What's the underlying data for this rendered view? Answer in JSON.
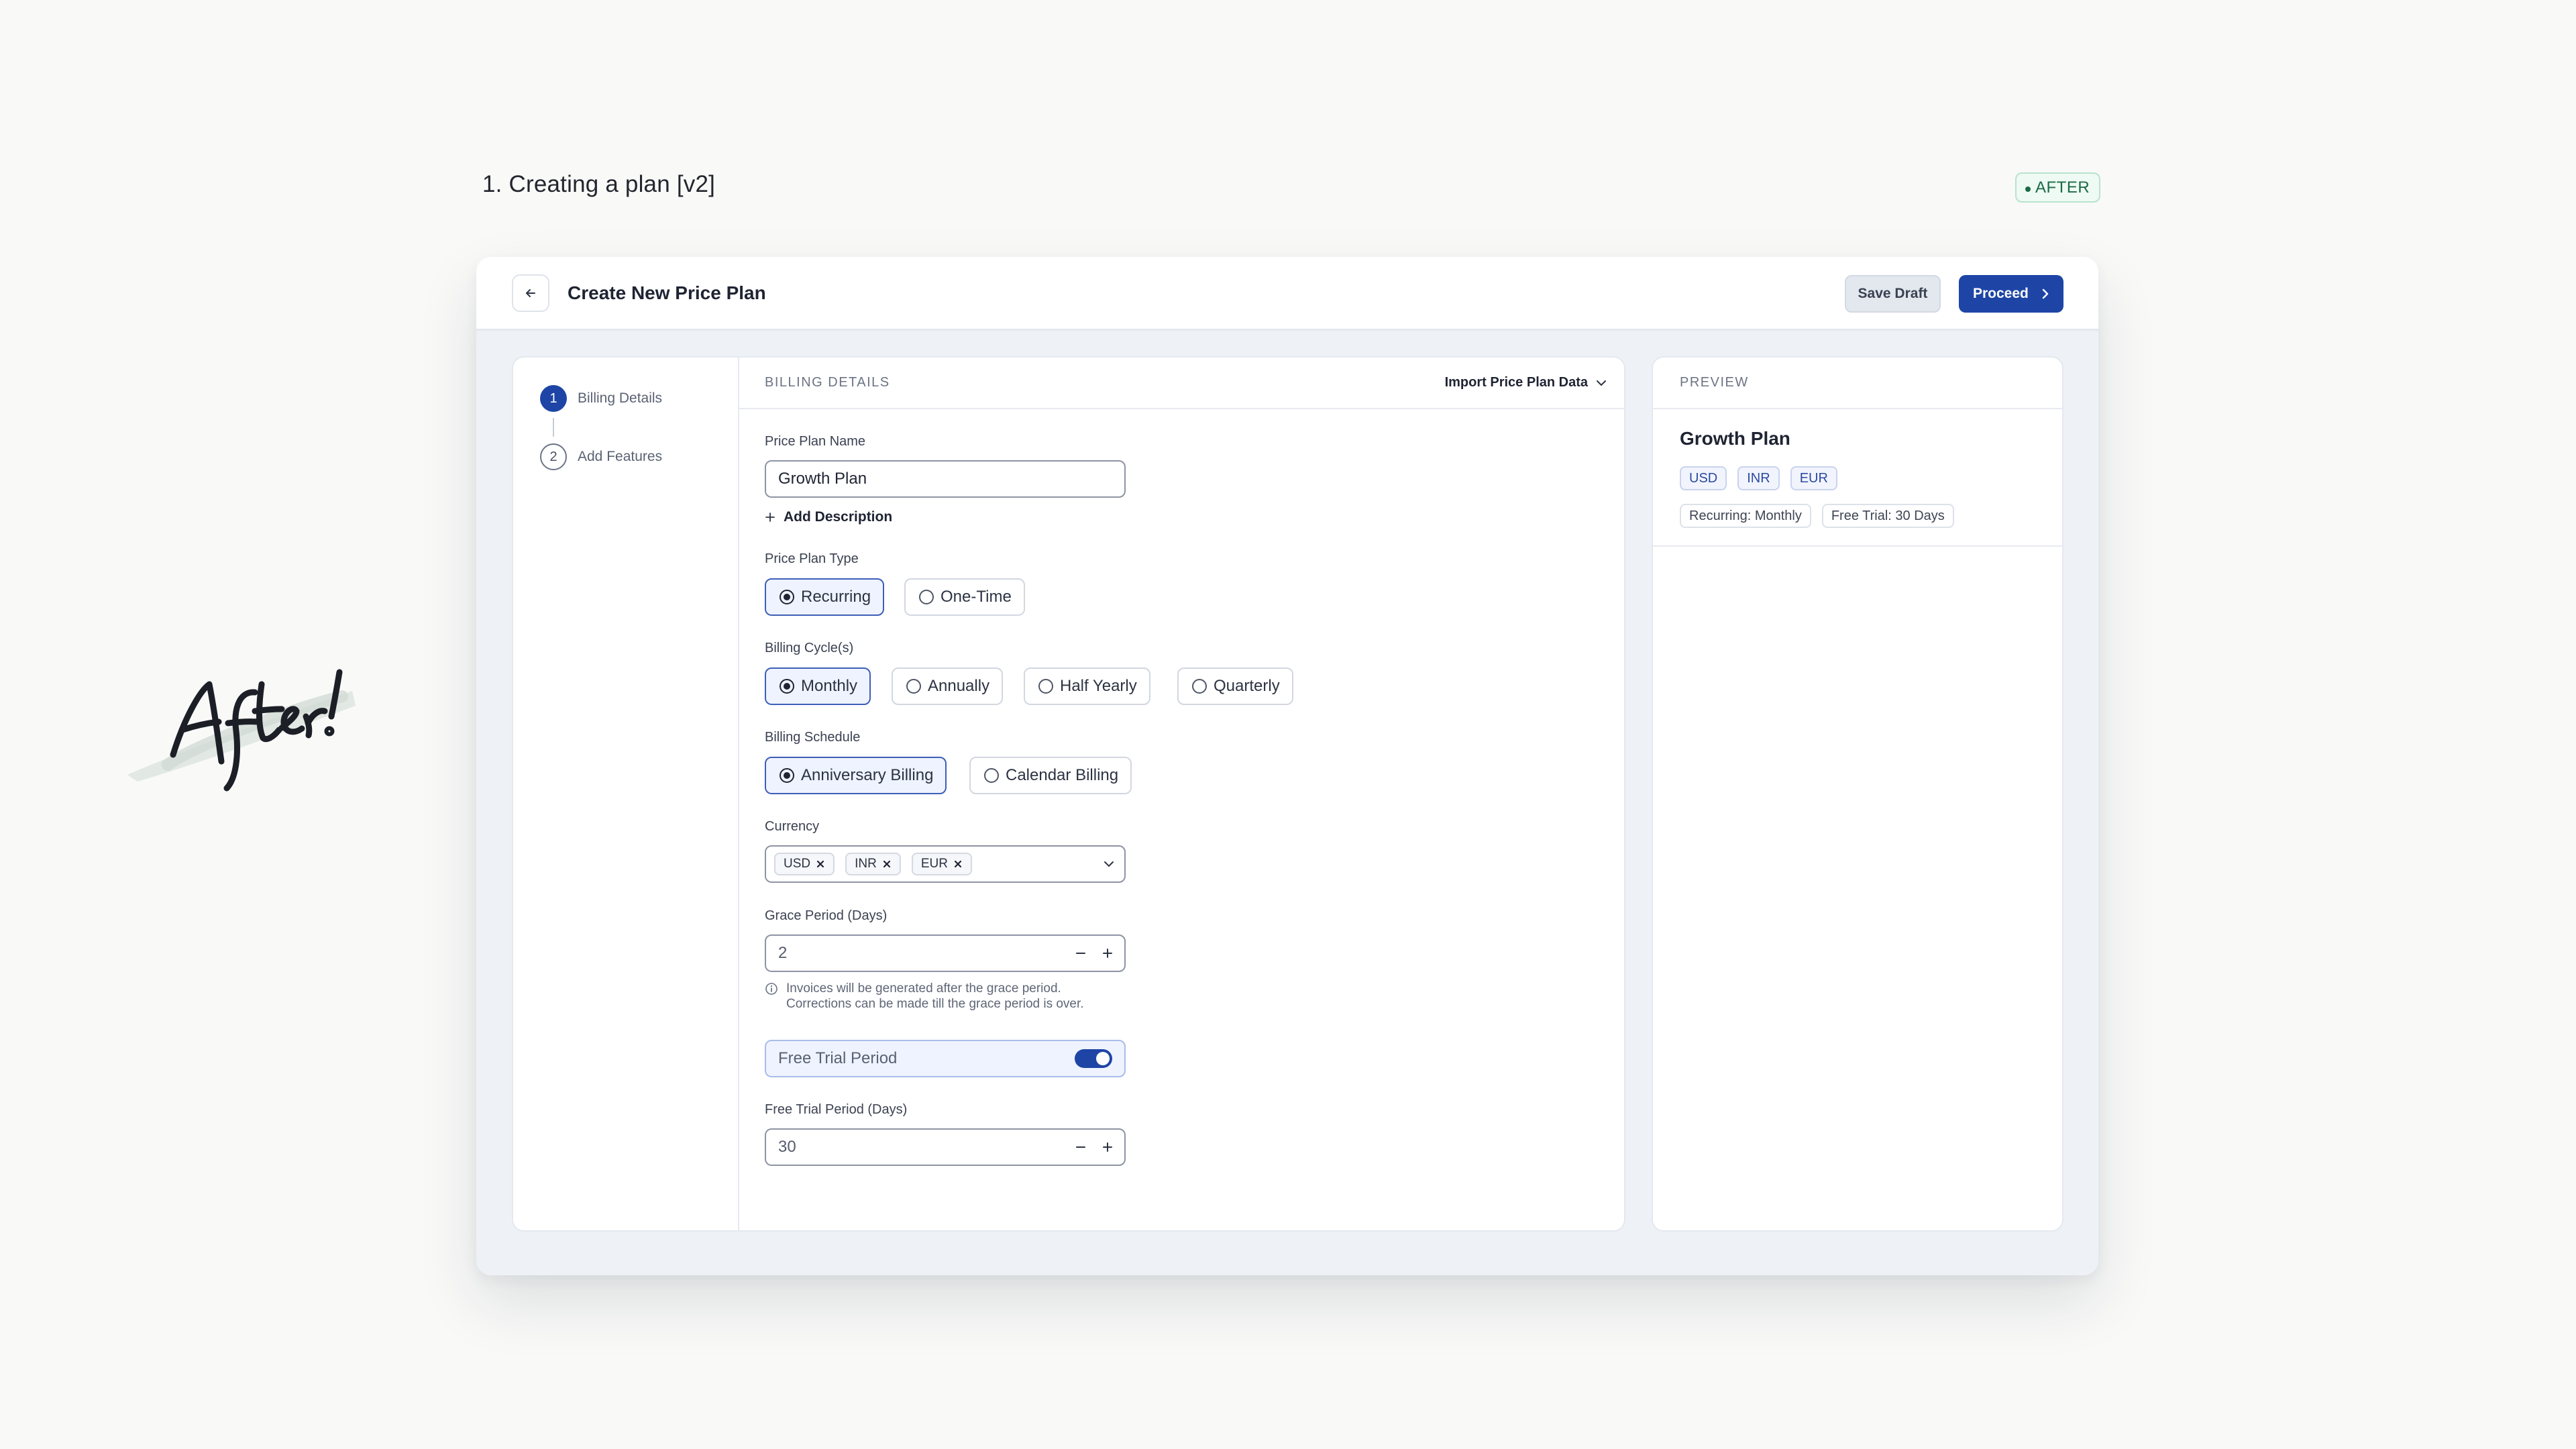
{
  "page": {
    "title": "1. Creating a plan [v2]",
    "badge": "AFTER",
    "handwritten_note": "After!"
  },
  "header": {
    "title": "Create New Price Plan",
    "save_draft": "Save Draft",
    "proceed": "Proceed"
  },
  "stepper": [
    {
      "number": "1",
      "label": "Billing Details",
      "active": true
    },
    {
      "number": "2",
      "label": "Add Features",
      "active": false
    }
  ],
  "form": {
    "section_label": "BILLING DETAILS",
    "import_label": "Import Price Plan Data",
    "plan_name": {
      "label": "Price Plan Name",
      "value": "Growth Plan"
    },
    "add_description": "Add Description",
    "plan_type": {
      "label": "Price Plan Type",
      "options": [
        "Recurring",
        "One-Time"
      ],
      "selected": "Recurring"
    },
    "billing_cycles": {
      "label": "Billing Cycle(s)",
      "options": [
        "Monthly",
        "Annually",
        "Half Yearly",
        "Quarterly"
      ],
      "selected": "Monthly"
    },
    "billing_schedule": {
      "label": "Billing Schedule",
      "options": [
        "Anniversary Billing",
        "Calendar Billing"
      ],
      "selected": "Anniversary Billing"
    },
    "currency": {
      "label": "Currency",
      "selected": [
        "USD",
        "INR",
        "EUR"
      ]
    },
    "grace_period": {
      "label": "Grace Period (Days)",
      "value": "2",
      "hint_line1": "Invoices will be generated after the grace period.",
      "hint_line2": "Corrections can be made till the grace period is over."
    },
    "free_trial_toggle": {
      "label": "Free Trial Period",
      "enabled": true
    },
    "free_trial_days": {
      "label": "Free Trial Period (Days)",
      "value": "30"
    }
  },
  "preview": {
    "section_label": "PREVIEW",
    "plan_name": "Growth Plan",
    "currencies": [
      "USD",
      "INR",
      "EUR"
    ],
    "meta": [
      "Recurring: Monthly",
      "Free Trial: 30 Days"
    ]
  },
  "colors": {
    "accent": "#1e45a6",
    "badge_green": "#1b6b47",
    "background": "#f9f9f8",
    "window_bg": "#eef2f7"
  }
}
